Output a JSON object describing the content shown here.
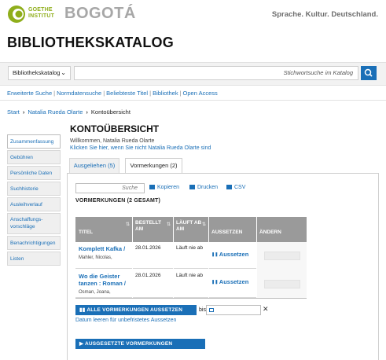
{
  "header": {
    "brand_line1": "GOETHE",
    "brand_line2": "INSTITUT",
    "city": "BOGOTÁ",
    "tagline": "Sprache. Kultur. Deutschland.",
    "page_heading": "BIBLIOTHEKSKATALOG"
  },
  "search": {
    "catalog_select": "Bibliothekskatalog",
    "placeholder": "Stichwortsuche im Katalog"
  },
  "links": [
    "Erweiterte Suche",
    "Normdatensuche",
    "Beliebteste Titel",
    "Bibliothek",
    "Open Access"
  ],
  "breadcrumb": {
    "start": "Start",
    "user": "Natalia Rueda Olarte",
    "current": "Kontoübersicht"
  },
  "sidebar": {
    "items": [
      "Zusammenfassung",
      "Gebühren",
      "Persönliche Daten",
      "Suchhistorie",
      "Ausleihverlauf",
      "Anschaffungs-vorschläge",
      "Benachrichtigungen",
      "Listen"
    ]
  },
  "main": {
    "title": "KONTOÜBERSICHT",
    "welcome": "Willkommen, Natalia Rueda Olarte",
    "not_you": "Klicken Sie hier, wenn Sie nicht Natalia Rueda Olarte sind",
    "tabs": [
      {
        "label": "Ausgeliehen (5)",
        "active": false
      },
      {
        "label": "Vormerkungen (2)",
        "active": true
      }
    ],
    "filter_placeholder": "Suche",
    "tools": {
      "copy": "Kopieren",
      "print": "Drucken",
      "csv": "CSV"
    },
    "reservations_heading": "VORMERKUNGEN (2 GESAMT)",
    "table": {
      "headers": [
        "TITEL",
        "BESTELLT AM",
        "LÄUFT AB AM",
        "AUSSETZEN",
        "ÄNDERN"
      ],
      "rows": [
        {
          "title": "Komplett Kafka /",
          "author": "Mahler, Nicolas,",
          "ordered": "28.01.2026",
          "expires": "Läuft nie ab",
          "suspend": "Aussetzen"
        },
        {
          "title": "Wo die Geister tanzen : Roman /",
          "author": "Osman, Joana,",
          "ordered": "28.01.2026",
          "expires": "Läuft nie ab",
          "suspend": "Aussetzen"
        }
      ]
    },
    "suspend_all": "▮▮ ALLE VORMERKUNGEN AUSSETZEN",
    "until_label": "bis",
    "clear_link": "Datum leeren für unbefristetes Aussetzen",
    "reactivate": "▶ AUSGESETZTE VORMERKUNGEN REAKTIVIEREN"
  },
  "colors": {
    "brand_green": "#8fae1b",
    "link_blue": "#1a6fb7",
    "table_header_gray": "#9a9a9a"
  }
}
